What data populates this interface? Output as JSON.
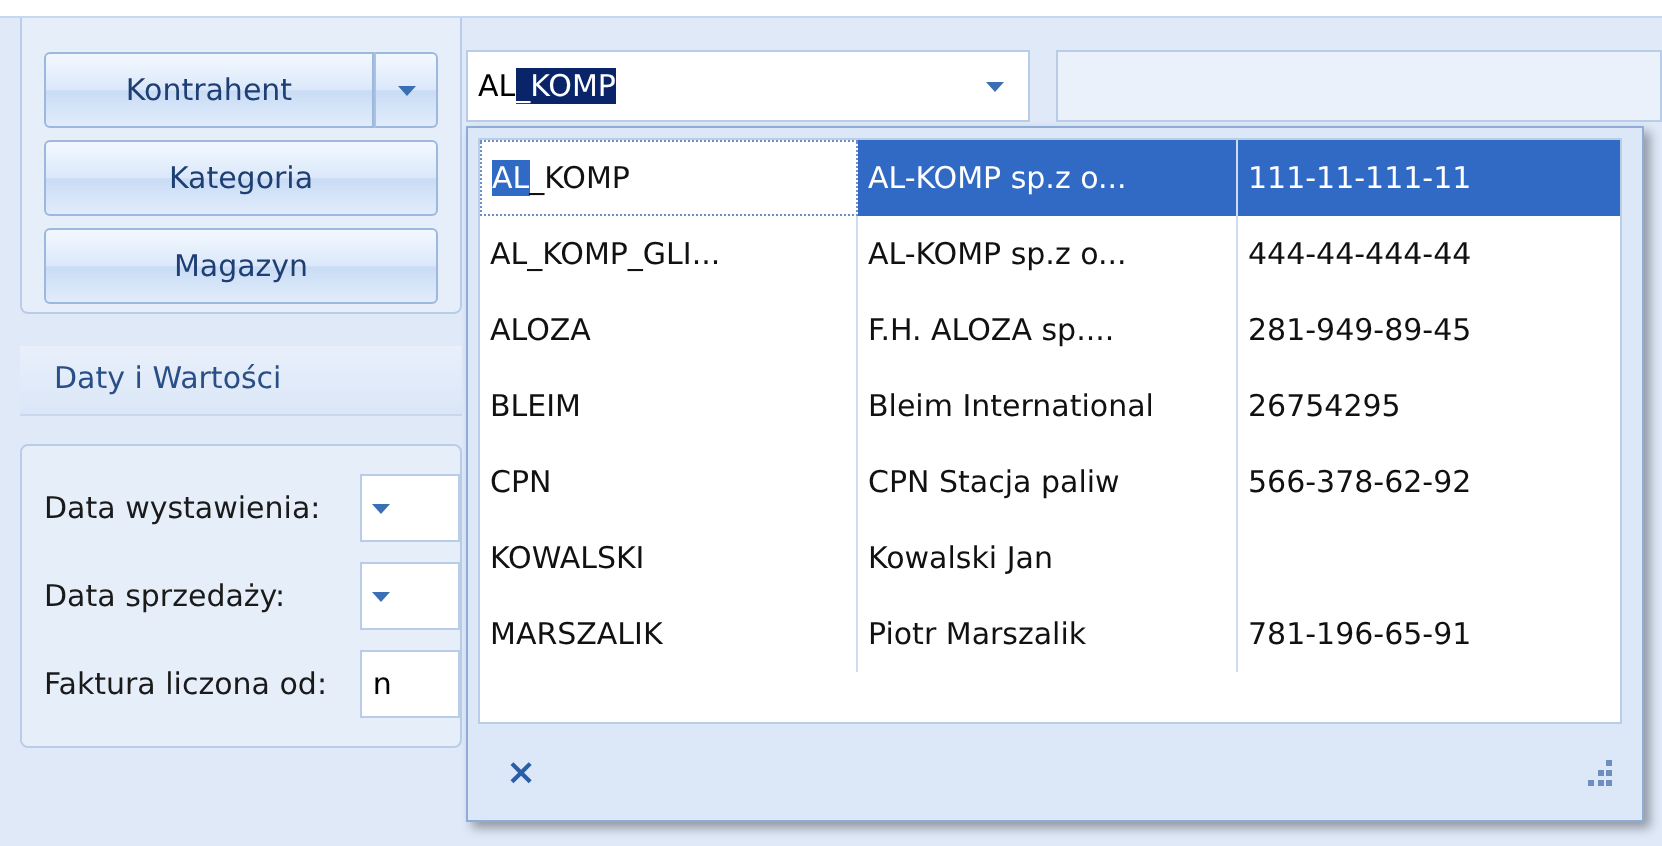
{
  "filter_buttons": [
    {
      "label": "Kontrahent",
      "has_dropdown": true
    },
    {
      "label": "Kategoria",
      "has_dropdown": false
    },
    {
      "label": "Magazyn",
      "has_dropdown": false
    }
  ],
  "combo": {
    "parts": [
      {
        "text": "AL",
        "highlight": false
      },
      {
        "text": "_KOMP",
        "highlight": true
      }
    ]
  },
  "tab": {
    "label": "Daty i Wartości"
  },
  "form_rows": [
    {
      "label": "Data wystawienia:",
      "kind": "dropdown"
    },
    {
      "label": "Data sprzedaży:",
      "kind": "dropdown"
    },
    {
      "label": "Faktura liczona od:",
      "kind": "text",
      "value": "n"
    }
  ],
  "dropdown_list": {
    "rows": [
      {
        "selected": true,
        "code_parts": [
          {
            "text": "AL",
            "highlight": true
          },
          {
            "text": "_KOMP",
            "highlight": false
          }
        ],
        "name": "AL-KOMP sp.z o...",
        "nip": "111-11-111-11"
      },
      {
        "selected": false,
        "code_parts": [
          {
            "text": "AL_KOMP_GLI...",
            "highlight": false
          }
        ],
        "name": "AL-KOMP sp.z o...",
        "nip": "444-44-444-44"
      },
      {
        "selected": false,
        "code_parts": [
          {
            "text": "ALOZA",
            "highlight": false
          }
        ],
        "name": "F.H. ALOZA sp....",
        "nip": "281-949-89-45"
      },
      {
        "selected": false,
        "code_parts": [
          {
            "text": "BLEIM",
            "highlight": false
          }
        ],
        "name": "Bleim International",
        "nip": "26754295"
      },
      {
        "selected": false,
        "code_parts": [
          {
            "text": "CPN",
            "highlight": false
          }
        ],
        "name": "CPN Stacja paliw",
        "nip": "566-378-62-92"
      },
      {
        "selected": false,
        "code_parts": [
          {
            "text": "KOWALSKI",
            "highlight": false
          }
        ],
        "name": "Kowalski Jan"
      },
      {
        "selected": false,
        "code_parts": [
          {
            "text": "MARSZALIK",
            "highlight": false
          }
        ],
        "name": "Piotr Marszalik",
        "nip": "781-196-65-91"
      }
    ],
    "footer_close": "×"
  }
}
